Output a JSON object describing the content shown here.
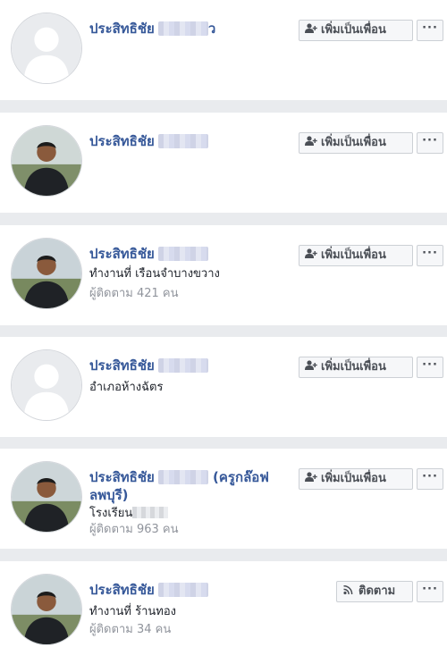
{
  "people": [
    {
      "name": "ประสิทธิชัย",
      "name_suffix": "ว",
      "has_photo": false,
      "lines": [],
      "action_label": "เพิ่มเป็นเพื่อน",
      "action_icon": "add-friend-icon"
    },
    {
      "name": "ประสิทธิชัย",
      "name_suffix": "",
      "has_photo": true,
      "lines": [],
      "action_label": "เพิ่มเป็นเพื่อน",
      "action_icon": "add-friend-icon"
    },
    {
      "name": "ประสิทธิชัย",
      "name_suffix": "",
      "has_photo": true,
      "lines": [
        "ทำงานที่ เรือนจำบางขวาง",
        "ผู้ติดตาม 421 คน"
      ],
      "action_label": "เพิ่มเป็นเพื่อน",
      "action_icon": "add-friend-icon"
    },
    {
      "name": "ประสิทธิชัย",
      "name_suffix": "",
      "has_photo": false,
      "lines": [
        "อำเภอห้างฉัตร"
      ],
      "action_label": "เพิ่มเป็นเพื่อน",
      "action_icon": "add-friend-icon"
    },
    {
      "name": "ประสิทธิชัย",
      "name_suffix": "(ครูกล๊อฟ ลพบุรี)",
      "has_photo": true,
      "lines": [
        "โรงเรียน",
        "ผู้ติดตาม 963 คน"
      ],
      "action_label": "เพิ่มเป็นเพื่อน",
      "action_icon": "add-friend-icon"
    },
    {
      "name": "ประสิทธิชัย",
      "name_suffix": "",
      "has_photo": true,
      "lines": [
        "ทำงานที่ ร้านทอง",
        "ผู้ติดตาม 34 คน"
      ],
      "action_label": "ติดตาม",
      "action_icon": "follow-rss-icon"
    }
  ],
  "more_label": "···",
  "colors": {
    "link": "#365899",
    "page_bg": "#e9ebee",
    "button_bg": "#f6f7f9",
    "button_border": "#ccd0d5"
  }
}
